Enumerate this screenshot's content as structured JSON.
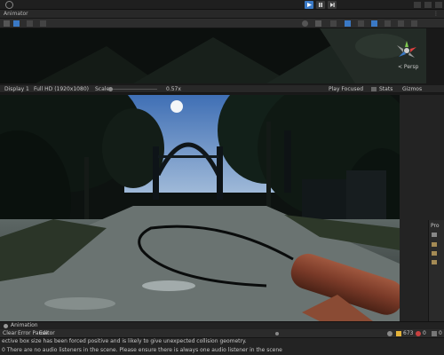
{
  "topbar": {
    "play_icon": "play-icon",
    "pause_icon": "pause-icon",
    "step_icon": "step-icon"
  },
  "scene": {
    "tab_label": "Animator",
    "gizmo_label": "< Persp"
  },
  "game": {
    "display": "Display 1",
    "resolution": "Full HD (1920x1080)",
    "scale_label": "Scale",
    "scale_value": "0.57x",
    "play_mode": "Play Focused",
    "stats": "Stats",
    "gizmos": "Gizmos"
  },
  "bottom": {
    "tab_label": "Animation",
    "console_tabs": [
      "Clear",
      "Error Pause",
      "Editor"
    ],
    "warning_count": "673",
    "error_count": "0",
    "message_count": "0",
    "message1": "ective box size has been forced positive and is likely to give unexpected collision geometry.",
    "message2": "0  There are no audio listeners in the scene. Please ensure there is always one audio listener in the scene"
  },
  "project": {
    "label": "Pro"
  },
  "colors": {
    "accent": "#3a79c5",
    "panel": "#282828",
    "warning": "#e4b33a"
  }
}
